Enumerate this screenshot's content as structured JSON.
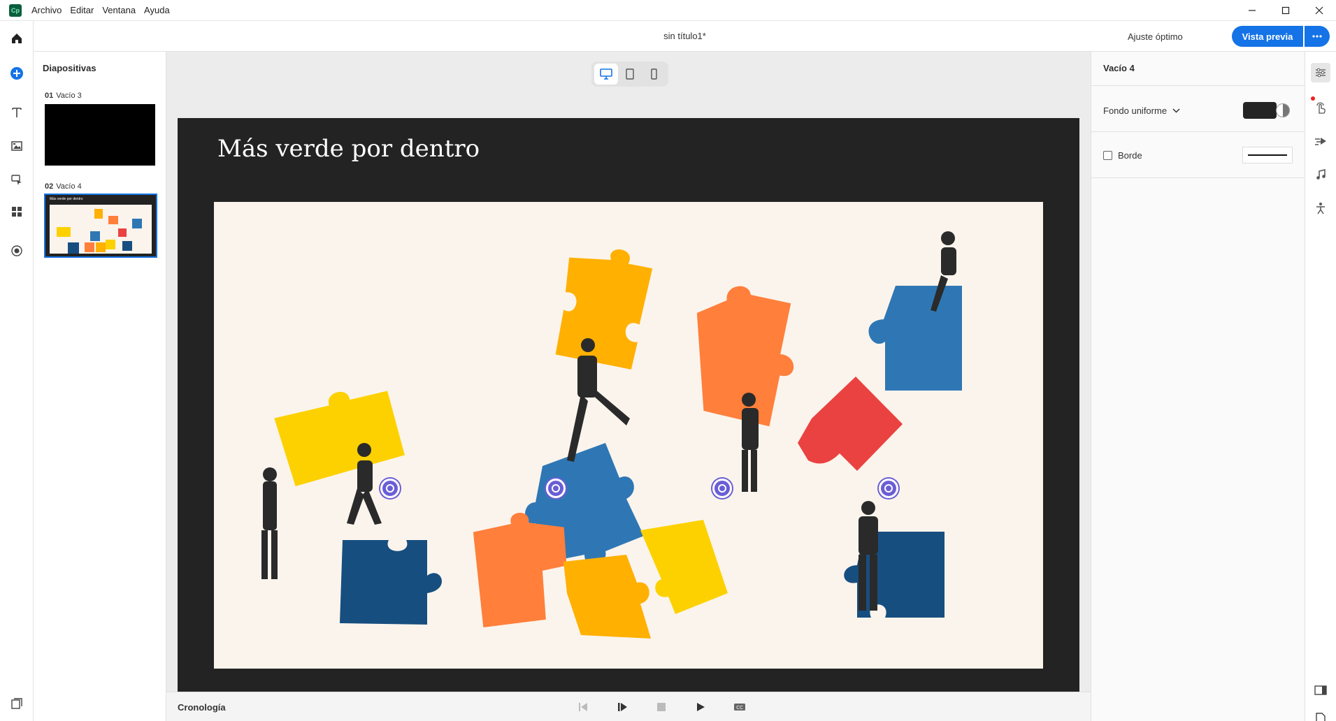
{
  "menu": {
    "app_icon": "Cp",
    "items": [
      "Archivo",
      "Editar",
      "Ventana",
      "Ayuda"
    ]
  },
  "window_controls": [
    "minimize-icon",
    "maximize-icon",
    "close-icon"
  ],
  "titlebar": {
    "document_title": "sin título1*",
    "zoom_value": "Ajuste óptimo",
    "preview_label": "Vista previa"
  },
  "left_toolbar": [
    "home-icon",
    "add-icon",
    "text-icon",
    "media-icon",
    "interactions-icon",
    "widgets-icon",
    "record-icon",
    "library-icon"
  ],
  "slides_panel": {
    "title": "Diapositivas",
    "slides": [
      {
        "number": "01",
        "name": "Vacío 3",
        "selected": false
      },
      {
        "number": "02",
        "name": "Vacío 4",
        "selected": true,
        "thumb_title": "Más verde por dentro"
      }
    ]
  },
  "stage": {
    "devices": [
      "desktop-icon",
      "tablet-icon",
      "mobile-icon"
    ],
    "active_device": "desktop",
    "slide_title": "Más verde por dentro",
    "hotspot_count": 4,
    "background_color": "#232323",
    "image_background": "#fbf4ec"
  },
  "timeline": {
    "label": "Cronología",
    "controls": [
      "previous-icon",
      "play-from-icon",
      "stop-icon",
      "play-icon",
      "cc-icon"
    ]
  },
  "properties": {
    "title": "Vacío 4",
    "background_label": "Fondo uniforme",
    "background_swatch": "#242424",
    "border_label": "Borde",
    "border_checked": false
  },
  "right_rail": [
    "properties-icon",
    "interactions-icon",
    "animation-icon",
    "audio-icon",
    "accessibility-icon",
    "panel-toggle-icon",
    "notes-icon"
  ],
  "colors": {
    "accent": "#1473e6",
    "hotspot": "#6a5ed6",
    "puzzle_yellow": "#fdd100",
    "puzzle_orange": "#ff7f3b",
    "puzzle_amber": "#ffb000",
    "puzzle_blue": "#2f77b4",
    "puzzle_navy": "#174e80",
    "puzzle_red": "#ea4240"
  }
}
